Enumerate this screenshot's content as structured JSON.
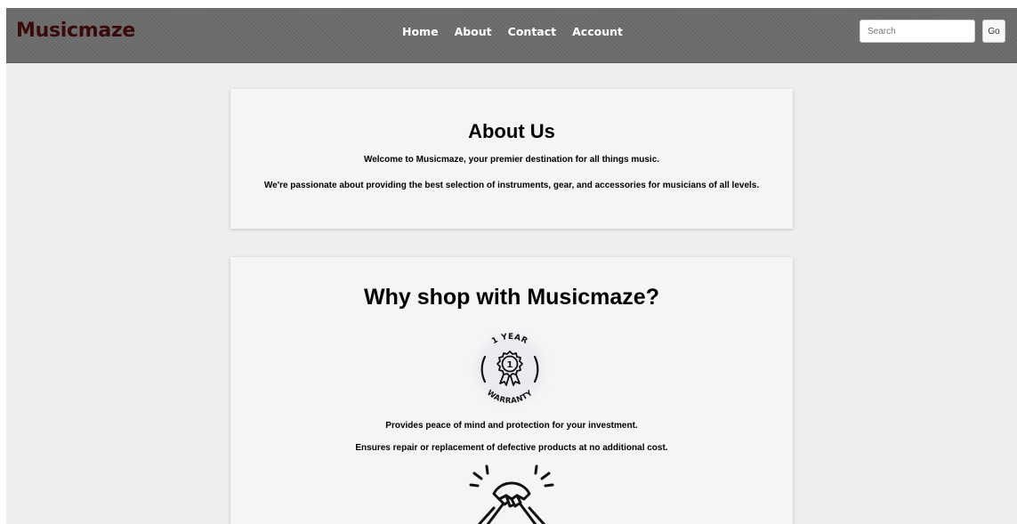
{
  "navbar": {
    "brand": "Musicmaze",
    "links": [
      "Home",
      "About",
      "Contact",
      "Account"
    ],
    "search_placeholder": "Search",
    "go_label": "Go"
  },
  "about": {
    "title": "About Us",
    "paragraphs": [
      "Welcome to Musicmaze, your premier destination for all things music.",
      "We're passionate about providing the best selection of instruments, gear, and accessories for musicians of all levels."
    ]
  },
  "why": {
    "title": "Why shop with Musicmaze?",
    "warranty_icon": "one-year-warranty-badge-icon",
    "warranty_badge_top": "1 YEAR",
    "warranty_badge_number": "1",
    "warranty_badge_bottom": "WARRANTY",
    "points": [
      "Provides peace of mind and protection for your investment.",
      "Ensures repair or replacement of defective products at no additional cost."
    ],
    "handshake_icon": "handshake-icon"
  },
  "colors": {
    "navbar_bg": "#6b6b6b",
    "brand": "#3a0a0a",
    "page_bg": "#eeeeee",
    "card_bg": "#f5f5f5"
  }
}
